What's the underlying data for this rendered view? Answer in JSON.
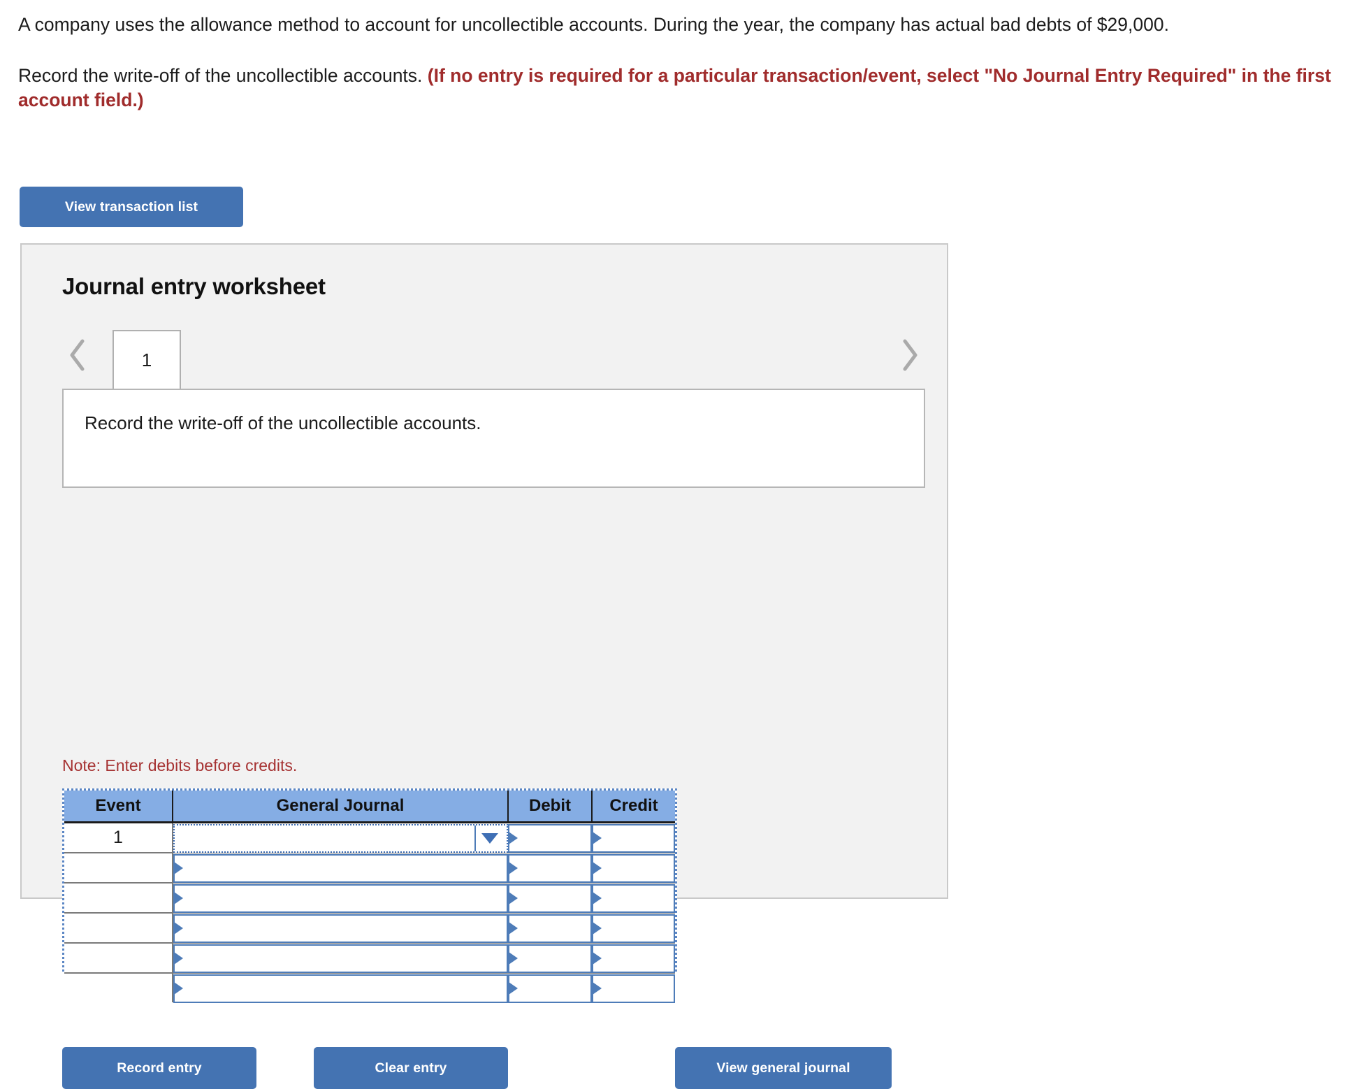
{
  "problem": {
    "paragraph1": "A company uses the allowance method to account for uncollectible accounts. During the year, the company has actual bad debts of $29,000.",
    "paragraph2_plain": "Record the write-off of the uncollectible accounts. ",
    "paragraph2_emphasis": "(If no entry is required for a particular transaction/event, select \"No Journal Entry Required\" in the first account field.)"
  },
  "buttons": {
    "view_transaction_list": "View transaction list",
    "record_entry": "Record entry",
    "clear_entry": "Clear entry",
    "view_general_journal": "View general journal"
  },
  "worksheet": {
    "title": "Journal entry worksheet",
    "prev_icon": "chevron-left-icon",
    "next_icon": "chevron-right-icon",
    "tabs": [
      {
        "label": "1",
        "active": true
      }
    ],
    "description": "Record the write-off of the uncollectible accounts.",
    "note": "Note: Enter debits before credits."
  },
  "journal_table": {
    "columns": [
      "Event",
      "General Journal",
      "Debit",
      "Credit"
    ],
    "rows": [
      {
        "event": "1",
        "general_journal": "",
        "debit": "",
        "credit": "",
        "focused": true
      },
      {
        "event": "",
        "general_journal": "",
        "debit": "",
        "credit": "",
        "focused": false
      },
      {
        "event": "",
        "general_journal": "",
        "debit": "",
        "credit": "",
        "focused": false
      },
      {
        "event": "",
        "general_journal": "",
        "debit": "",
        "credit": "",
        "focused": false
      },
      {
        "event": "",
        "general_journal": "",
        "debit": "",
        "credit": "",
        "focused": false
      },
      {
        "event": "",
        "general_journal": "",
        "debit": "",
        "credit": "",
        "focused": false
      }
    ],
    "dropdown_icon": "chevron-down-icon"
  },
  "colors": {
    "button_blue": "#4473b2",
    "table_header_blue": "#85ade4",
    "cell_border_blue": "#4e7cb8",
    "red_emphasis": "#a02c2c",
    "note_red": "#a63232",
    "panel_bg": "#f2f2f2",
    "panel_border": "#c9c9c9"
  }
}
